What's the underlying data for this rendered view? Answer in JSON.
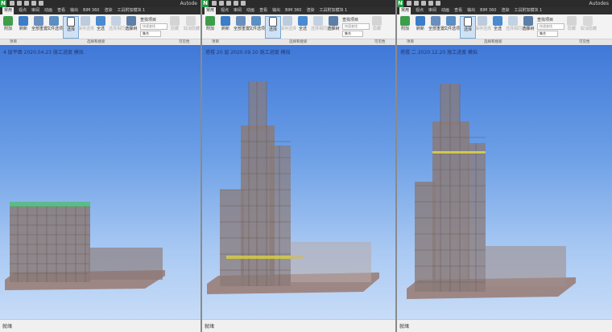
{
  "panes": [
    {
      "app_icon": "N",
      "title": "Autode",
      "tabs": [
        "常用",
        "视点",
        "审阅",
        "动画",
        "查看",
        "输出",
        "BIM 360",
        "渲染",
        "工具附加模块 1"
      ],
      "ribbon": {
        "buttons": [
          "附加",
          "刷新",
          "全部重置...",
          "文件选项",
          "选择",
          "保存选择",
          "全选",
          "选择相同对象",
          "选择树",
          "隐藏",
          "取消隐藏",
          "可见性"
        ],
        "find_items": "查找项目",
        "quick_find_placeholder": "快速查找",
        "set_label": "集合",
        "groups": [
          "项目",
          "选择和搜索",
          "可见性"
        ]
      },
      "viewport_label": "4 层平面 2020.04.23 施工进度 模拟",
      "status": "就绪"
    },
    {
      "app_icon": "N",
      "title": "",
      "tabs": [
        "常用",
        "视点",
        "审阅",
        "动画",
        "查看",
        "输出",
        "BIM 360",
        "渲染",
        "工具附加模块 1"
      ],
      "ribbon": {
        "buttons": [
          "附加",
          "刷新",
          "全部重置...",
          "文件选项",
          "选择",
          "保存选择",
          "全选",
          "选择相同对象",
          "选择树",
          "隐藏",
          "取消隐藏",
          "可见性"
        ],
        "find_items": "查找项目",
        "quick_find_placeholder": "快速查找",
        "set_label": "集合",
        "groups": [
          "项目",
          "选择和搜索",
          "可见性"
        ]
      },
      "viewport_label": "塔楼 20 层 2020.09.10 施工进度 模拟",
      "status": "就绪"
    },
    {
      "app_icon": "N",
      "title": "Autodes",
      "tabs": [
        "常用",
        "视点",
        "审阅",
        "动画",
        "查看",
        "输出",
        "BIM 360",
        "渲染",
        "工具附加模块 1"
      ],
      "ribbon": {
        "buttons": [
          "附加",
          "刷新",
          "全部重置...",
          "文件选项",
          "选择",
          "保存选择",
          "全选",
          "选择相同对象",
          "选择树",
          "隐藏",
          "取消隐藏",
          "可见性"
        ],
        "find_items": "查找项目",
        "quick_find_placeholder": "快速查找",
        "set_label": "集合",
        "groups": [
          "项目",
          "选择和搜索",
          "可见性"
        ]
      },
      "viewport_label": "塔楼 二 2020.12.20 施工进度 模拟",
      "status": "就绪"
    }
  ],
  "colors": {
    "sky_top": "#3f78d8",
    "sky_bottom": "#c7dcf7",
    "structure": "#8a7a78",
    "base_slab": "#9d8785",
    "scaffold_green": "#4bbf6a",
    "progress_yellow": "#d8d040"
  }
}
